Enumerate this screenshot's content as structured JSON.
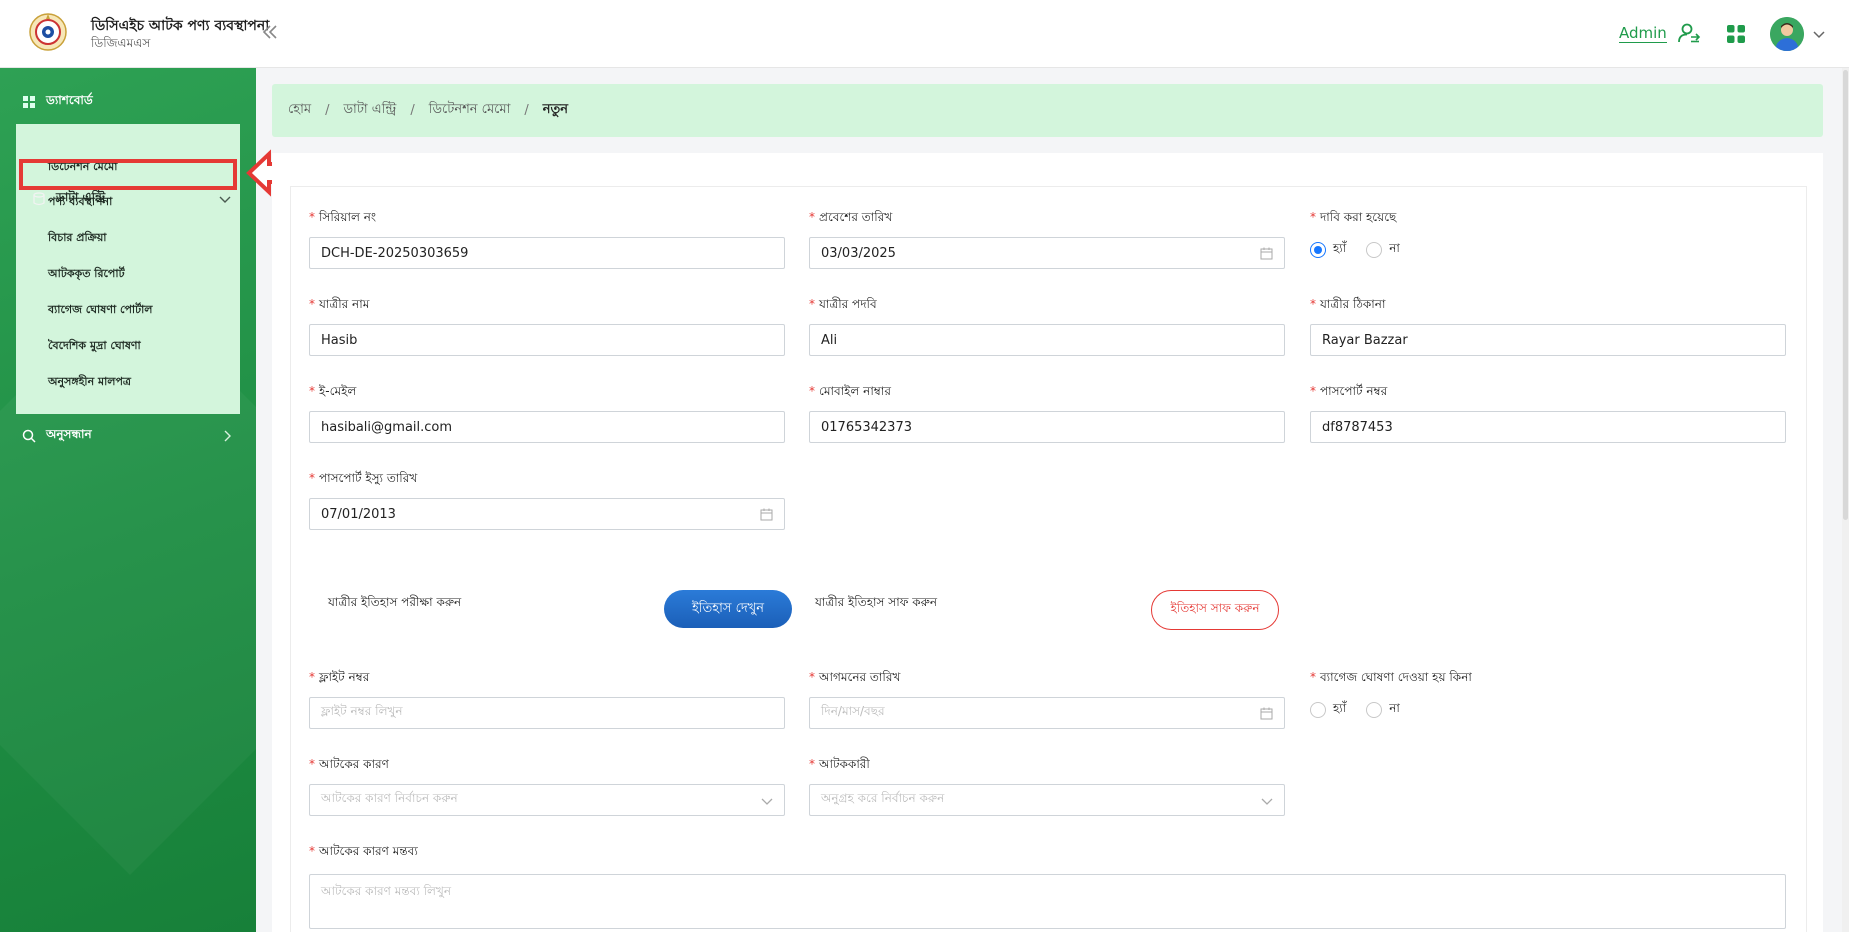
{
  "header": {
    "app_title": "ডিসিএইচ আটক পণ্য ব্যবস্থাপনা",
    "app_subtitle": "ডিজিএমএস",
    "user_name": "Admin",
    "icons": [
      "logo-emblem",
      "double-chevron-left-icon",
      "user-switch-icon",
      "apps-grid-icon",
      "avatar",
      "chevron-down-icon"
    ]
  },
  "sidebar": {
    "dashboard": "ড্যাশবোর্ড",
    "data_entry": "ডাটা এন্ট্রি",
    "children": [
      "ডিটেনশন মেমো",
      "পণ্য ব্যবস্থাপনা",
      "বিচার প্রক্রিয়া",
      "আটককৃত রিপোর্ট",
      "ব্যাগেজ ঘোষণা পোর্টাল",
      "বৈদেশিক মুদ্রা ঘোষণা",
      "অনুসঙ্গহীন মালপত্র"
    ],
    "search": "অনুসন্ধান"
  },
  "breadcrumb": {
    "home": "হোম",
    "data_entry": "ডাটা এন্ট্রি",
    "detention_memo": "ডিটেনশন মেমো",
    "current": "নতুন",
    "separator": "/"
  },
  "form": {
    "required_mark": "*",
    "serial_no": {
      "label": "সিরিয়াল নং",
      "value": "DCH-DE-20250303659"
    },
    "entry_date": {
      "label": "প্রবেশের তারিখ",
      "value": "03/03/2025"
    },
    "claimed": {
      "label": "দাবি করা হয়েছে",
      "options": [
        "হ্যাঁ",
        "না"
      ],
      "selected": "হ্যাঁ"
    },
    "passenger_name": {
      "label": "যাত্রীর নাম",
      "value": "Hasib"
    },
    "passenger_title": {
      "label": "যাত্রীর পদবি",
      "value": "Ali"
    },
    "passenger_address": {
      "label": "যাত্রীর ঠিকানা",
      "value": "Rayar Bazzar"
    },
    "email": {
      "label": "ই-মেইল",
      "value": "hasibali@gmail.com"
    },
    "mobile": {
      "label": "মোবাইল নাম্বার",
      "value": "01765342373"
    },
    "passport_no": {
      "label": "পাসপোর্ট নম্বর",
      "value": "df8787453"
    },
    "passport_issue_date": {
      "label": "পাসপোর্ট ইস্যু তারিখ",
      "value": "07/01/2013"
    },
    "history_check": {
      "label": "যাত্রীর ইতিহাস পরীক্ষা করুন",
      "button": "ইতিহাস দেখুন"
    },
    "history_clear": {
      "label": "যাত্রীর ইতিহাস সাফ করুন",
      "button": "ইতিহাস সাফ করুন"
    },
    "flight_no": {
      "label": "ফ্লাইট নম্বর",
      "placeholder": "ফ্লাইট নম্বর লিখুন"
    },
    "arrival_date": {
      "label": "আগমনের তারিখ",
      "placeholder": "দিন/মাস/বছর"
    },
    "baggage_declared": {
      "label": "ব্যাগেজ ঘোষণা দেওয়া হয় কিনা",
      "options": [
        "হ্যাঁ",
        "না"
      ],
      "selected": ""
    },
    "detention_reason": {
      "label": "আটকের কারণ",
      "placeholder": "আটকের কারণ নির্বাচন করুন"
    },
    "detainer": {
      "label": "আটককারী",
      "placeholder": "অনুগ্রহ করে নির্বাচন করুন"
    },
    "reason_comment": {
      "label": "আটকের কারণ মন্তব্য",
      "placeholder": "আটকের কারণ মন্তব্য লিখুন"
    }
  },
  "colors": {
    "sidebar_green": "#1f8e44",
    "highlight_bg": "#d3f5dc",
    "primary_blue": "#1b5fb8",
    "danger_red": "#e53935",
    "accent_green": "#1f9b4b"
  }
}
